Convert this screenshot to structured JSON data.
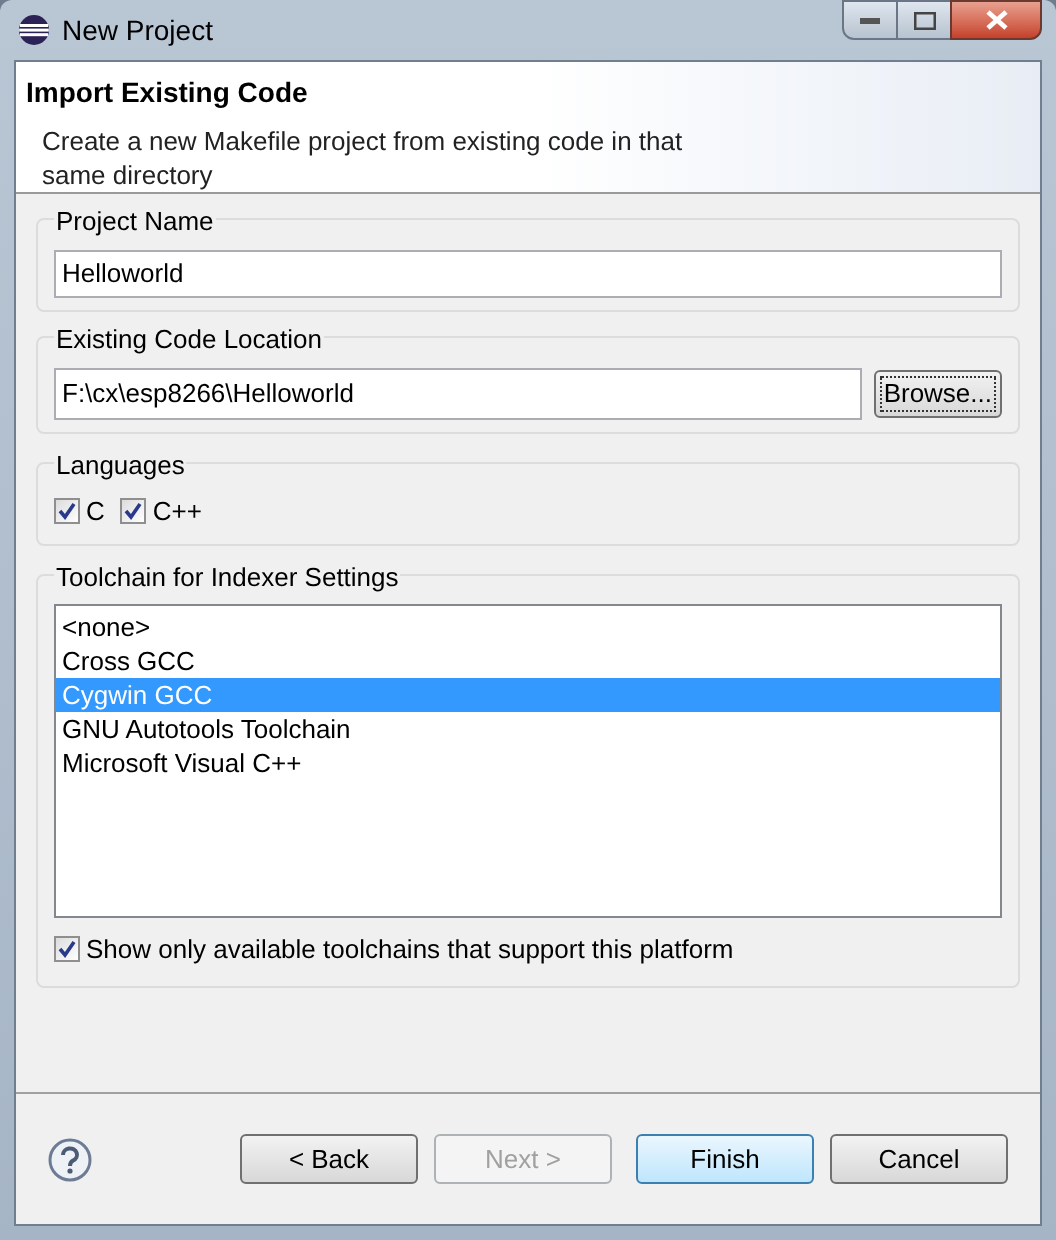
{
  "window": {
    "title": "New Project"
  },
  "header": {
    "title": "Import Existing Code",
    "description": "Create a new Makefile project from existing code in that same directory"
  },
  "project_name": {
    "label": "Project Name",
    "value": "Helloworld"
  },
  "code_location": {
    "label": "Existing Code Location",
    "value": "F:\\cx\\esp8266\\Helloworld",
    "button": "Browse..."
  },
  "languages": {
    "label": "Languages",
    "items": [
      {
        "label": "C",
        "checked": true
      },
      {
        "label": "C++",
        "checked": true
      }
    ]
  },
  "toolchain": {
    "label": "Toolchain for Indexer Settings",
    "items": [
      {
        "label": "<none>",
        "selected": false
      },
      {
        "label": "Cross GCC",
        "selected": false
      },
      {
        "label": "Cygwin GCC",
        "selected": true
      },
      {
        "label": "GNU Autotools Toolchain",
        "selected": false
      },
      {
        "label": "Microsoft Visual C++",
        "selected": false
      }
    ],
    "filter": {
      "label": "Show only available toolchains that support this platform",
      "checked": true
    }
  },
  "buttons": [
    {
      "label": "< Back",
      "disabled": false,
      "default": false
    },
    {
      "label": "Next >",
      "disabled": true,
      "default": false
    },
    {
      "label": "Finish",
      "disabled": false,
      "default": true
    },
    {
      "label": "Cancel",
      "disabled": false,
      "default": false
    }
  ]
}
